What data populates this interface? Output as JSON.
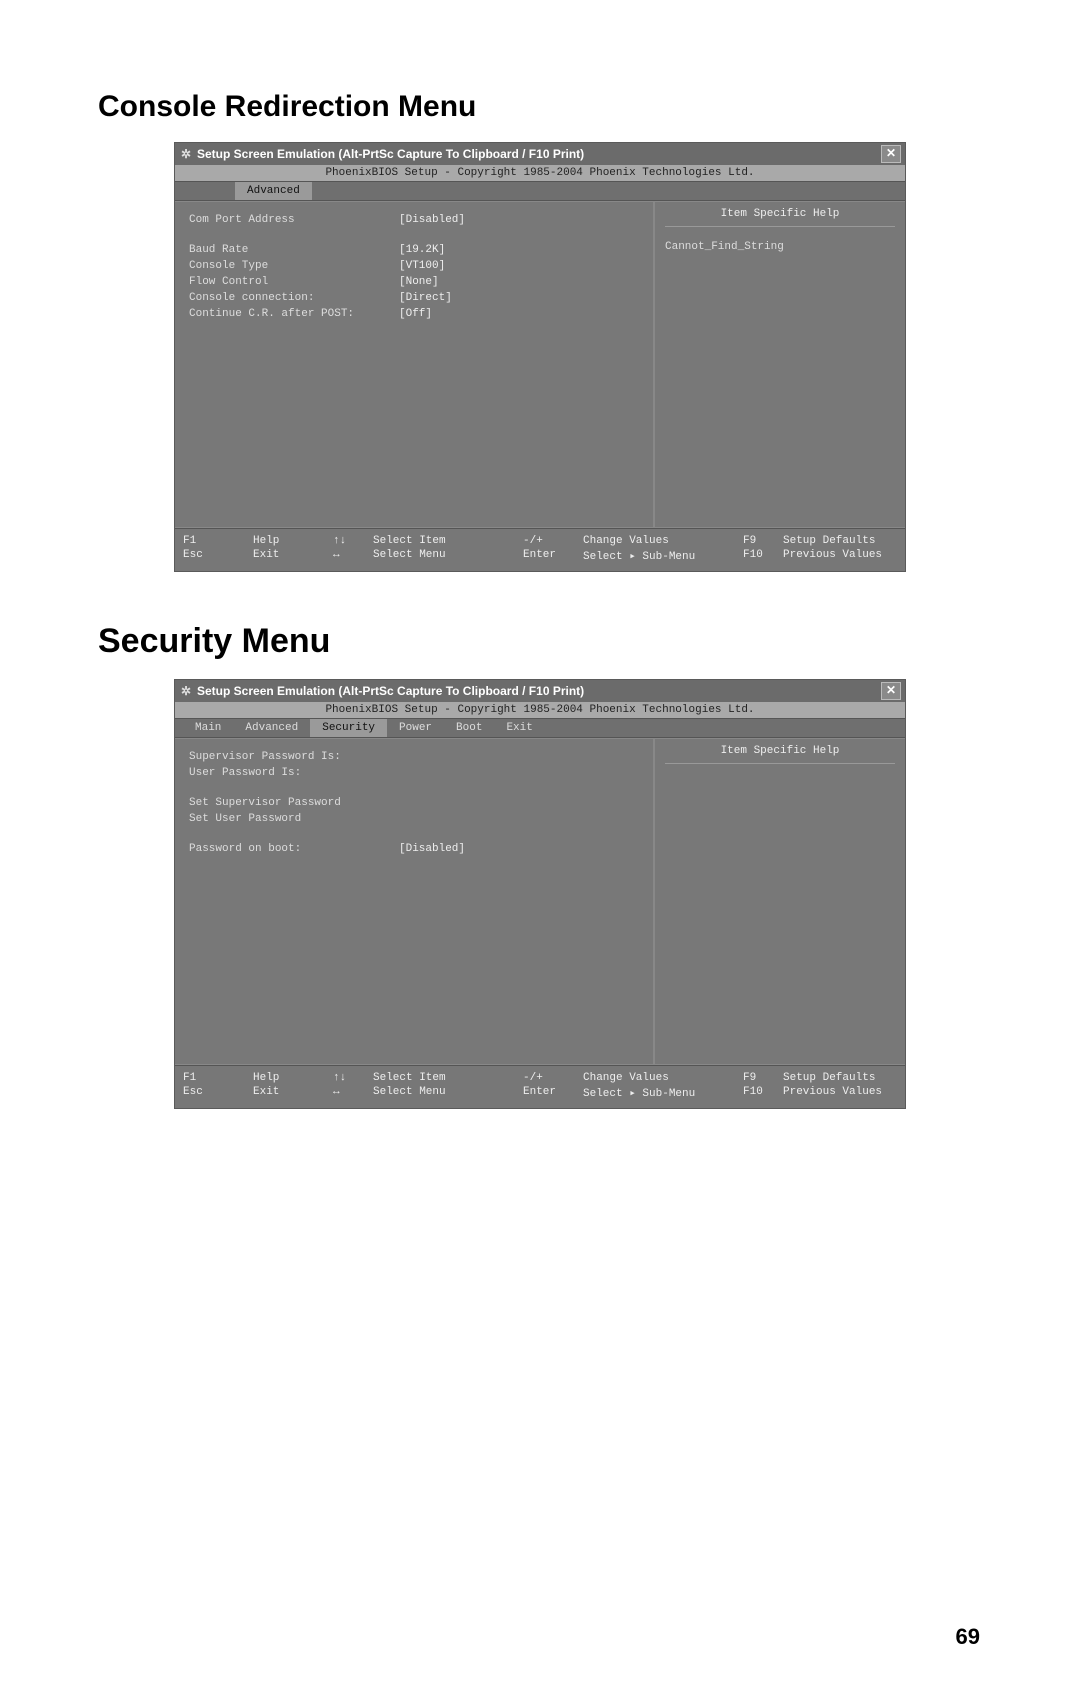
{
  "page_number": "69",
  "section1": {
    "heading": "Console Redirection Menu",
    "titlebar": "Setup Screen Emulation (Alt-PrtSc Capture To Clipboard / F10 Print)",
    "copyright": "PhoenixBIOS Setup - Copyright 1985-2004 Phoenix Technologies Ltd.",
    "active_tab": "Advanced",
    "help_title": "Item Specific Help",
    "help_body": "Cannot_Find_String",
    "settings": {
      "com_port_label": "Com Port Address",
      "com_port_value": "[Disabled]",
      "baud_label": "Baud Rate",
      "baud_value": "[19.2K]",
      "console_type_label": "Console Type",
      "console_type_value": "[VT100]",
      "flow_label": "Flow Control",
      "flow_value": "[None]",
      "conn_label": "Console connection:",
      "conn_value": "[Direct]",
      "cont_label": "Continue C.R. after POST:",
      "cont_value": "[Off]"
    }
  },
  "section2": {
    "heading": "Security Menu",
    "titlebar": "Setup Screen Emulation (Alt-PrtSc Capture To Clipboard / F10 Print)",
    "copyright": "PhoenixBIOS Setup - Copyright 1985-2004 Phoenix Technologies Ltd.",
    "tabs": {
      "main": "Main",
      "advanced": "Advanced",
      "security": "Security",
      "power": "Power",
      "boot": "Boot",
      "exit": "Exit"
    },
    "active_tab": "Security",
    "help_title": "Item Specific Help",
    "settings": {
      "sup_label": "Supervisor Password Is:",
      "user_label": "User Password Is:",
      "set_sup_label": "Set Supervisor Password",
      "set_user_label": "Set User Password",
      "pob_label": "Password on boot:",
      "pob_value": "[Disabled]"
    }
  },
  "footer": {
    "f1": "F1",
    "esc": "Esc",
    "help": "Help",
    "exit": "Exit",
    "updown": "↑↓",
    "leftright": "↔",
    "select_item": "Select Item",
    "select_menu": "Select Menu",
    "minus_plus": "-/+",
    "enter": "Enter",
    "change_values": "Change Values",
    "select_sub": "Select ▸ Sub-Menu",
    "f9": "F9",
    "f10": "F10",
    "setup_defaults": "Setup Defaults",
    "previous_values": "Previous Values"
  }
}
